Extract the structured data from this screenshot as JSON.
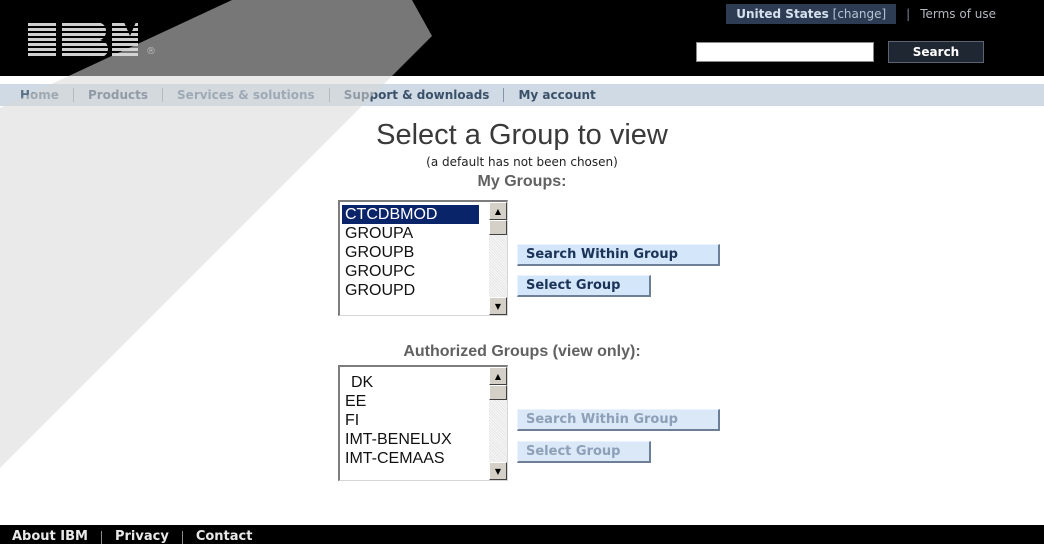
{
  "masthead": {
    "logo_text": "IBM",
    "reg_mark": "®",
    "country": "United States",
    "change_link": "[change]",
    "terms_link": "Terms of use",
    "search_placeholder": "",
    "search_button": "Search"
  },
  "nav": {
    "items": [
      "Home",
      "Products",
      "Services & solutions",
      "Support & downloads",
      "My account"
    ]
  },
  "page": {
    "title": "Select a Group to view",
    "subtitle": "(a default has not been chosen)"
  },
  "my_groups": {
    "heading": "My Groups:",
    "items": [
      "CTCDBMOD",
      "GROUPA",
      "GROUPB",
      "GROUPC",
      "GROUPD"
    ],
    "selected": "CTCDBMOD",
    "search_button": "Search Within Group",
    "select_button": "Select Group"
  },
  "authorized_groups": {
    "heading": "Authorized Groups (view only):",
    "items": [
      "DK",
      "EE",
      "FI",
      "IMT-BENELUX",
      "IMT-CEMAAS"
    ],
    "search_button": "Search Within Group",
    "select_button": "Select Group"
  },
  "footer": {
    "links": [
      "About IBM",
      "Privacy",
      "Contact"
    ]
  },
  "colors": {
    "masthead_bg": "#000000",
    "nav_bg": "#cfdae4",
    "button_bg": "#d4e6fa",
    "selection_bg": "#0a246a"
  }
}
